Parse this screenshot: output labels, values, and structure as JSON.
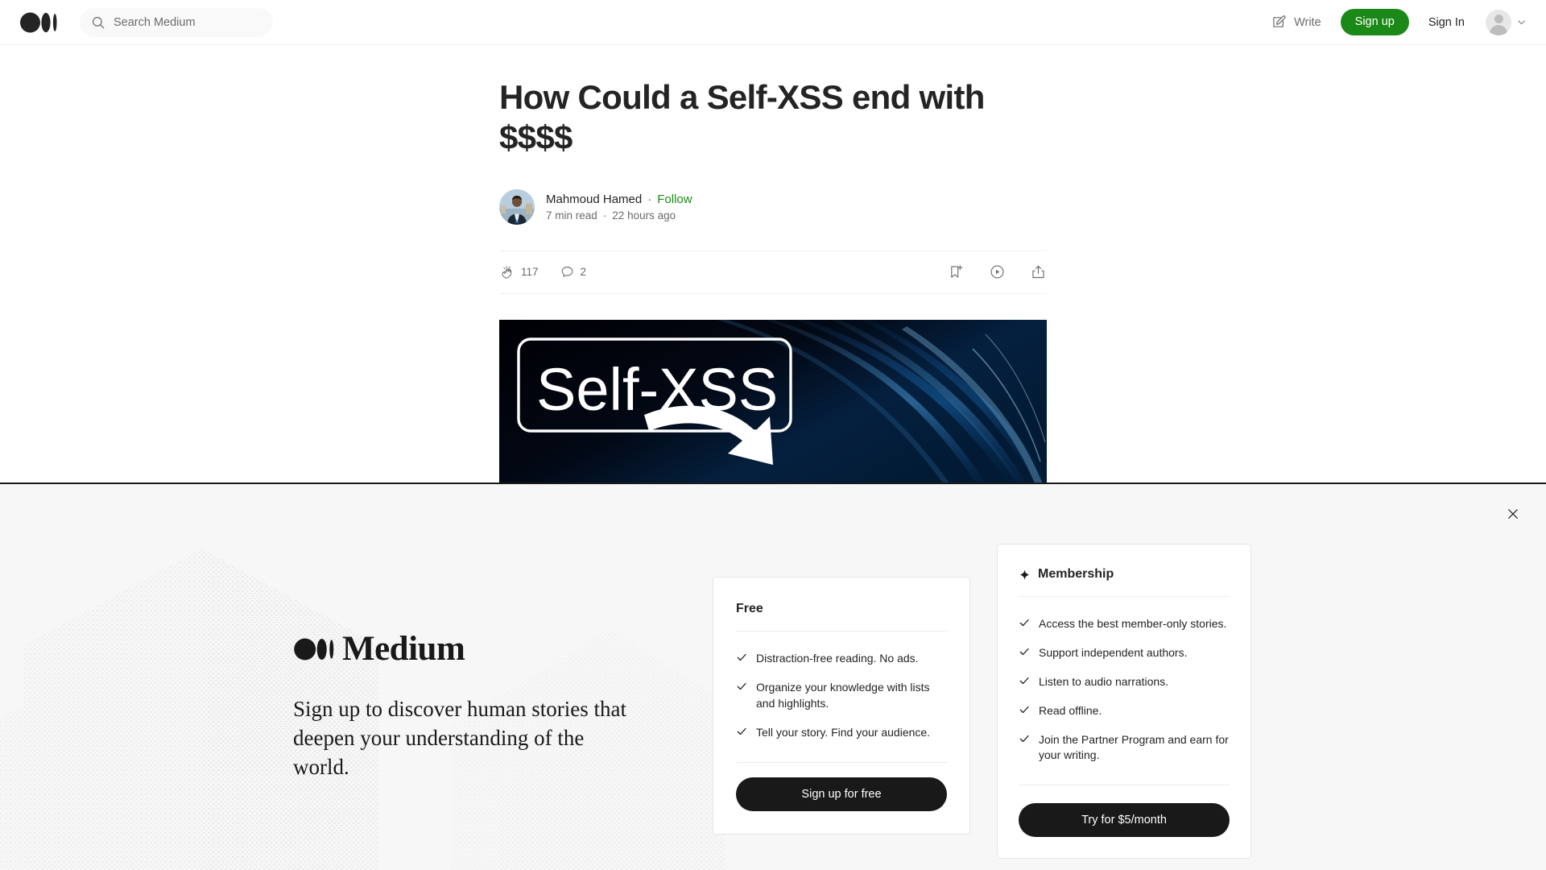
{
  "header": {
    "logo_name": "medium-logo",
    "search": {
      "placeholder": "Search Medium",
      "value": "",
      "icon": "search-icon"
    },
    "write_label": "Write",
    "write_icon": "pencil-write-icon",
    "signup_label": "Sign up",
    "signin_label": "Sign In",
    "avatar_icon": "user-avatar-placeholder",
    "chevron_icon": "chevron-down-icon",
    "signup_color": "#1a8917"
  },
  "article": {
    "title": "How Could a Self-XSS end with $$$$",
    "author": {
      "name": "Mahmoud Hamed",
      "separator": "·",
      "follow_label": "Follow",
      "follow_color": "#1a8917",
      "read_time": "7 min read",
      "meta_separator": "·",
      "published": "22 hours ago",
      "avatar_name": "author-avatar"
    },
    "engagement": {
      "clap_icon": "clap-icon",
      "clap_count": "117",
      "comment_icon": "comment-icon",
      "comment_count": "2",
      "save_icon": "bookmark-add-icon",
      "listen_icon": "play-circle-listen-icon",
      "share_icon": "share-icon"
    },
    "hero": {
      "name": "article-hero-image",
      "label_text": "Self-XSS",
      "bg_color": "#000005",
      "accent_color": "#1a6fd4"
    }
  },
  "banner": {
    "close_icon": "close-icon",
    "brand_name": "Medium",
    "brand_logo_name": "medium-logo",
    "tagline": "Sign up to discover human stories that deepen your understanding of the world.",
    "background_color": "#f7f7f7",
    "free_card": {
      "title": "Free",
      "features": [
        "Distraction-free reading. No ads.",
        "Organize your knowledge with lists and highlights.",
        "Tell your story. Find your audience."
      ],
      "cta_label": "Sign up for free"
    },
    "membership_card": {
      "title": "Membership",
      "title_icon": "sparkle-star-icon",
      "features": [
        "Access the best member-only stories.",
        "Support independent authors.",
        "Listen to audio narrations.",
        "Read offline.",
        "Join the Partner Program and earn for your writing."
      ],
      "cta_label": "Try for $5/month"
    }
  }
}
